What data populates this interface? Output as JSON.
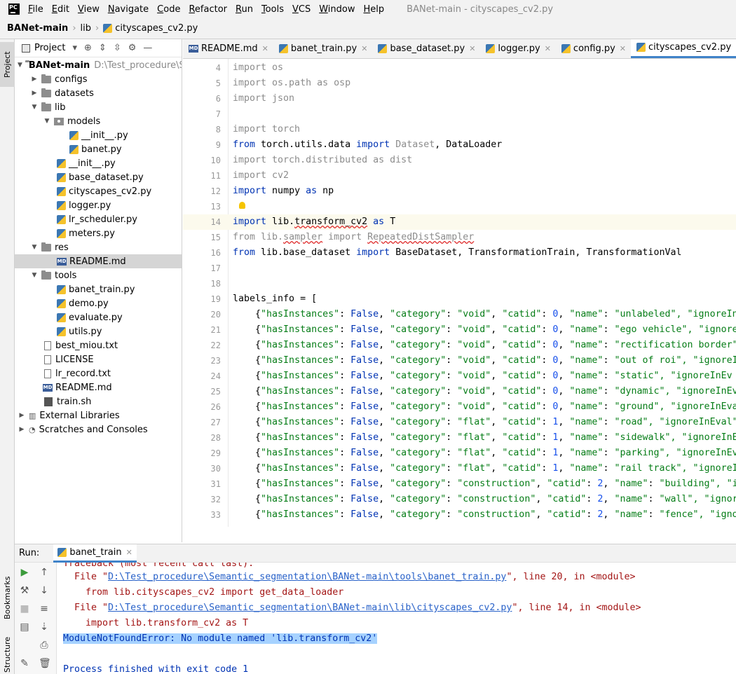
{
  "menu": {
    "items": [
      "File",
      "Edit",
      "View",
      "Navigate",
      "Code",
      "Refactor",
      "Run",
      "Tools",
      "VCS",
      "Window",
      "Help"
    ],
    "window_title": "BANet-main - cityscapes_cv2.py"
  },
  "breadcrumb": {
    "root": "BANet-main",
    "folder": "lib",
    "file": "cityscapes_cv2.py"
  },
  "side_tabs": {
    "project": "Project",
    "bookmarks": "Bookmarks",
    "structure": "Structure"
  },
  "project": {
    "header": "Project",
    "root_name": "BANet-main",
    "root_path": "D:\\Test_procedure\\S",
    "configs": "configs",
    "datasets": "datasets",
    "lib": "lib",
    "models": "models",
    "models_init": "__init__.py",
    "banet": "banet.py",
    "lib_init": "__init__.py",
    "base_dataset": "base_dataset.py",
    "cityscapes": "cityscapes_cv2.py",
    "logger": "logger.py",
    "lr_scheduler": "lr_scheduler.py",
    "meters": "meters.py",
    "res": "res",
    "res_readme": "README.md",
    "tools": "tools",
    "banet_train": "banet_train.py",
    "demo": "demo.py",
    "evaluate": "evaluate.py",
    "utils": "utils.py",
    "best_miou": "best_miou.txt",
    "license": "LICENSE",
    "lr_record": "lr_record.txt",
    "readme": "README.md",
    "train_sh": "train.sh",
    "ext_libs": "External Libraries",
    "scratches": "Scratches and Consoles"
  },
  "tabs": {
    "t1": "README.md",
    "t2": "banet_train.py",
    "t3": "base_dataset.py",
    "t4": "logger.py",
    "t5": "config.py",
    "t6": "cityscapes_cv2.py"
  },
  "code_lines": {
    "n4": "4",
    "n5": "5",
    "n6": "6",
    "n7": "7",
    "n8": "8",
    "n9": "9",
    "n10": "10",
    "n11": "11",
    "n12": "12",
    "n13": "13",
    "n14": "14",
    "n15": "15",
    "n16": "16",
    "n17": "17",
    "n18": "18",
    "n19": "19",
    "n20": "20",
    "n21": "21",
    "n22": "22",
    "n23": "23",
    "n24": "24",
    "n25": "25",
    "n26": "26",
    "n27": "27",
    "n28": "28",
    "n29": "29",
    "n30": "30",
    "n31": "31",
    "n32": "32",
    "n33": "33"
  },
  "labels_rows": [
    {
      "category": "\"void\"",
      "catid": "0",
      "name": "\"unlabeled\"",
      "tail": ", \"ignoreIn"
    },
    {
      "category": "\"void\"",
      "catid": "0",
      "name": "\"ego vehicle\"",
      "tail": ", \"ignore"
    },
    {
      "category": "\"void\"",
      "catid": "0",
      "name": "\"rectification border\"",
      "tail": ""
    },
    {
      "category": "\"void\"",
      "catid": "0",
      "name": "\"out of roi\"",
      "tail": ", \"ignoreI"
    },
    {
      "category": "\"void\"",
      "catid": "0",
      "name": "\"static\"",
      "tail": ", \"ignoreInEv"
    },
    {
      "category": "\"void\"",
      "catid": "0",
      "name": "\"dynamic\"",
      "tail": ", \"ignoreInEv"
    },
    {
      "category": "\"void\"",
      "catid": "0",
      "name": "\"ground\"",
      "tail": ", \"ignoreInEva"
    },
    {
      "category": "\"flat\"",
      "catid": "1",
      "name": "\"road\"",
      "tail": ", \"ignoreInEval\""
    },
    {
      "category": "\"flat\"",
      "catid": "1",
      "name": "\"sidewalk\"",
      "tail": ", \"ignoreInE"
    },
    {
      "category": "\"flat\"",
      "catid": "1",
      "name": "\"parking\"",
      "tail": ", \"ignoreInEv"
    },
    {
      "category": "\"flat\"",
      "catid": "1",
      "name": "\"rail track\"",
      "tail": ", \"ignoreI"
    },
    {
      "category": "\"construction\"",
      "catid": "2",
      "name": "\"building\"",
      "tail": ", \"i"
    },
    {
      "category": "\"construction\"",
      "catid": "2",
      "name": "\"wall\"",
      "tail": ", \"ignor"
    },
    {
      "category": "\"construction\"",
      "catid": "2",
      "name": "\"fence\"",
      "tail": ", \"igno"
    }
  ],
  "run": {
    "label": "Run:",
    "tab": "banet_train",
    "partial": "Traceback (most recent call last):",
    "file1_prefix": "  File \"",
    "file1_path": "D:\\Test_procedure\\Semantic_segmentation\\BANet-main\\tools\\banet_train.py",
    "file1_suffix": "\", line 20, in <module>",
    "code1": "    from lib.cityscapes_cv2 import get_data_loader",
    "file2_prefix": "  File \"",
    "file2_path": "D:\\Test_procedure\\Semantic_segmentation\\BANet-main\\lib\\cityscapes_cv2.py",
    "file2_suffix": "\", line 14, in <module>",
    "code2": "    import lib.transform_cv2 as T",
    "error": "ModuleNotFoundError: No module named 'lib.transform_cv2'",
    "exit": "Process finished with exit code 1"
  }
}
